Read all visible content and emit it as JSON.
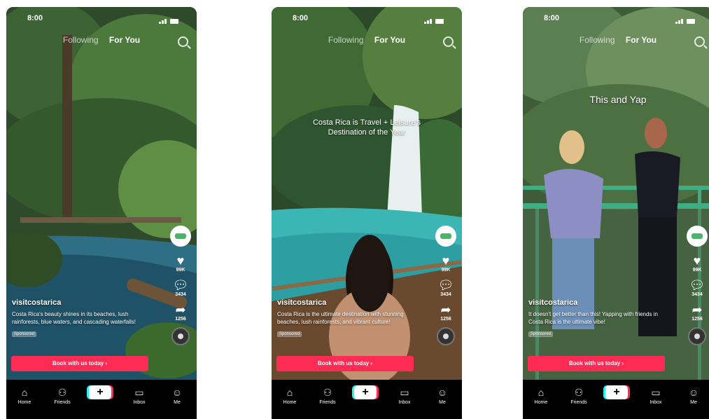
{
  "status": {
    "time": "8:00"
  },
  "tabs": {
    "following": "Following",
    "for_you": "For You"
  },
  "nav": {
    "home": "Home",
    "friends": "Friends",
    "plus": "+",
    "inbox": "Inbox",
    "me": "Me"
  },
  "icons": {
    "like": "heart-icon",
    "comment": "comment-icon",
    "share": "share-icon",
    "search": "search-icon"
  },
  "colors": {
    "cta": "#fe2c55",
    "accent_cyan": "#25f4ee"
  },
  "phones": [
    {
      "overlay": "",
      "user": "visitcostarica",
      "desc": "Costa Rica's beauty shines in its beaches, lush rainforests, blue waters, and cascading waterfalls!",
      "sponsored": "Sponsored",
      "cta": "Book with us today ›",
      "likes": "99K",
      "comments": "3434",
      "shares": "1256"
    },
    {
      "overlay": "Costa Rica is Travel + Leisure's Destination of the Year",
      "user": "visitcostarica",
      "desc": "Costa Rica is the ultimate destination with stunning beaches, lush rainforests, and vibrant culture!",
      "sponsored": "Sponsored",
      "cta": "Book with us today ›",
      "likes": "99K",
      "comments": "3434",
      "shares": "1256"
    },
    {
      "overlay": "This and Yap",
      "user": "visitcostarica",
      "desc": "It doesn't get better than this! Yapping with friends in Costa Rica is the ultimate vibe!",
      "sponsored": "Sponsored",
      "cta": "Book with us today ›",
      "likes": "99K",
      "comments": "3434",
      "shares": "1256"
    }
  ]
}
